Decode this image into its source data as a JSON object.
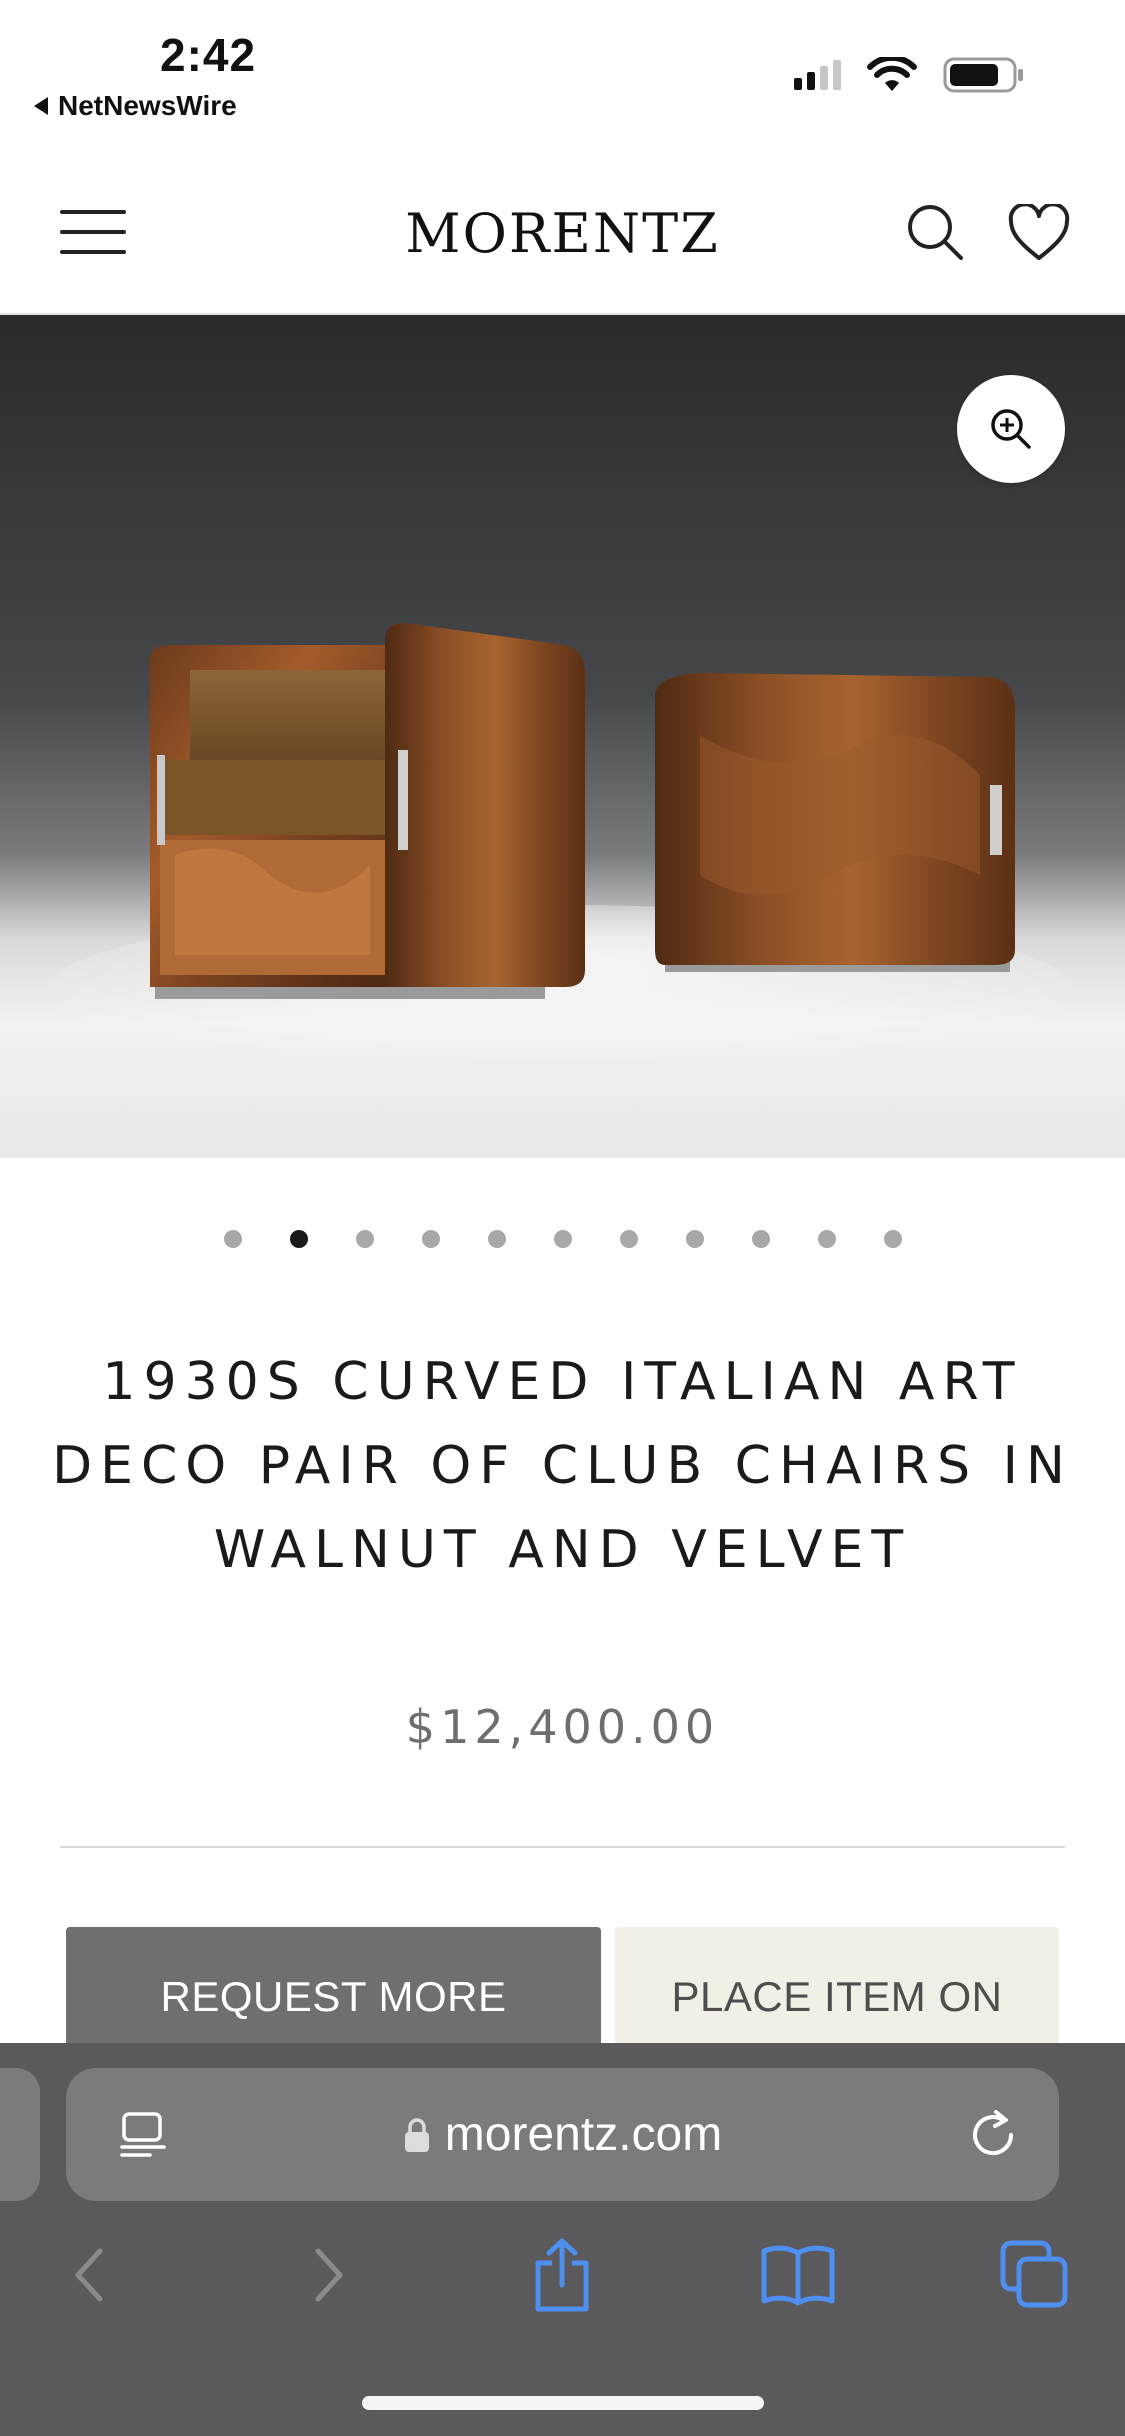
{
  "status_bar": {
    "time": "2:42",
    "back_app": "NetNewsWire",
    "signal_bars": 2,
    "battery_level": 0.75
  },
  "header": {
    "logo": "MORENTZ",
    "icons": [
      "menu-icon",
      "search-icon",
      "heart-icon"
    ]
  },
  "gallery": {
    "image_description": "Pair of walnut art deco club chairs on grey studio background",
    "slide_count": 11,
    "active_slide": 2,
    "zoom_icon": "zoom-in-icon"
  },
  "product": {
    "title": "1930s Curved Italian Art Deco Pair of Club Chairs in Walnut and Velvet",
    "price": "$12,400.00"
  },
  "actions": {
    "request_more": "REQUEST MORE",
    "place_item_on": "PLACE ITEM ON"
  },
  "safari": {
    "url": "morentz.com",
    "toolbar_icons": [
      "back-icon",
      "forward-icon",
      "share-icon",
      "bookmarks-icon",
      "tabs-icon"
    ],
    "accent": "#3b82f6"
  }
}
